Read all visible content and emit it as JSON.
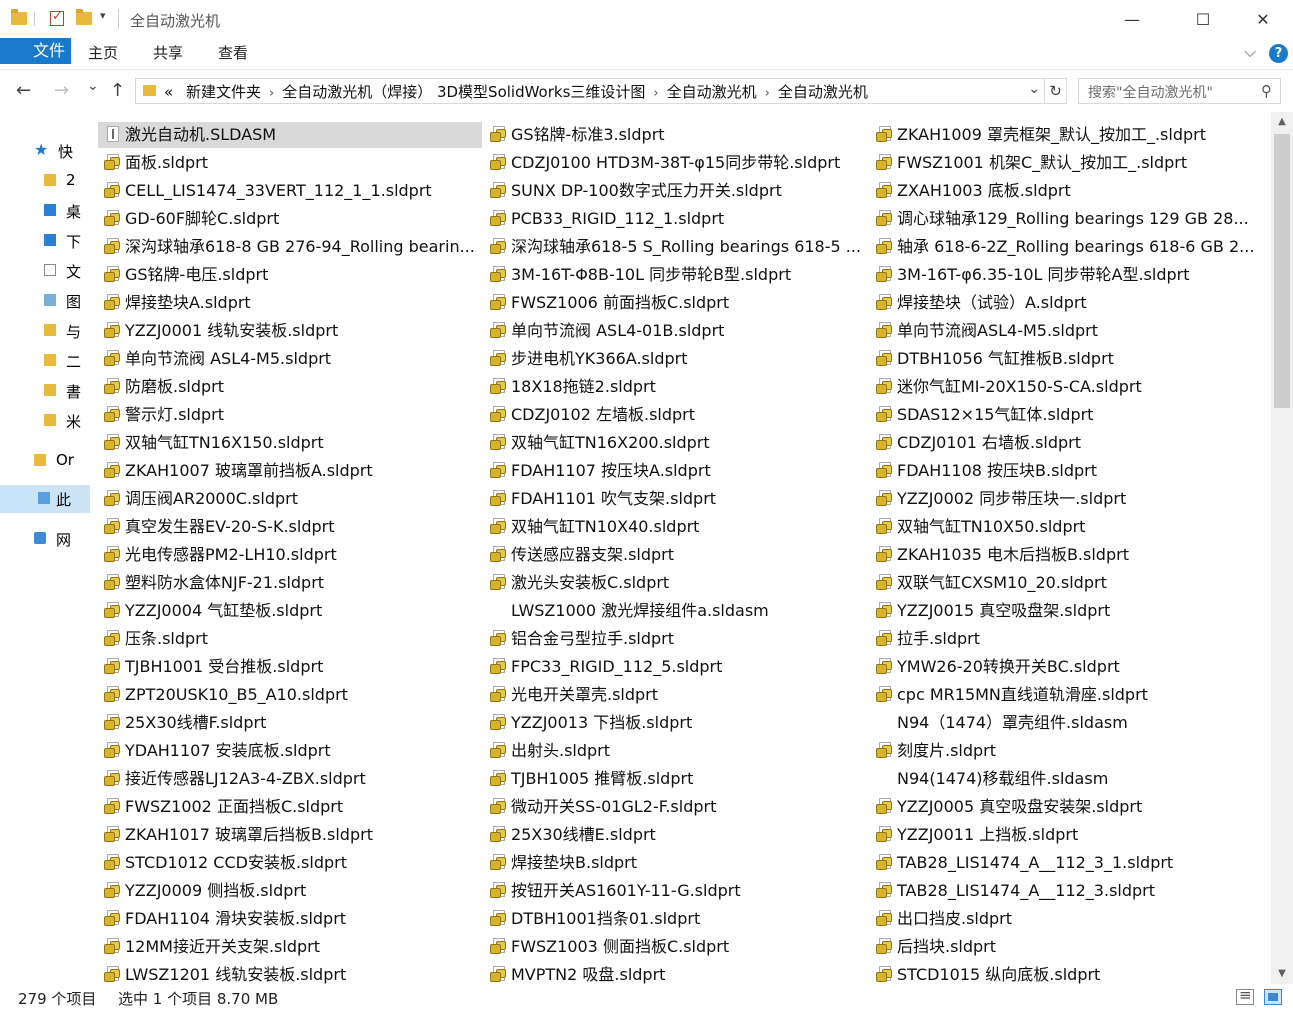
{
  "window": {
    "title": "全自动激光机",
    "minimize_glyph": "—",
    "maximize_glyph": "☐",
    "close_glyph": "✕"
  },
  "ribbon": {
    "tabs": [
      {
        "label": "文件"
      },
      {
        "label": "主页"
      },
      {
        "label": "共享"
      },
      {
        "label": "查看"
      }
    ],
    "collapse_glyph": "⌵",
    "help_glyph": "?"
  },
  "navigation": {
    "back_glyph": "←",
    "forward_glyph": "→",
    "recent_glyph": "⌄",
    "up_glyph": "↑",
    "overflow_glyph": "«",
    "crumbs": [
      "新建文件夹",
      "全自动激光机（焊接） 3D模型SolidWorks三维设计图",
      "全自动激光机",
      "全自动激光机"
    ],
    "dropdown_glyph": "⌄",
    "refresh_glyph": "↻",
    "search_placeholder": "搜索\"全自动激光机\"",
    "search_glyph": "⚲"
  },
  "sidebar": {
    "items": [
      {
        "label": "快"
      },
      {
        "label": "2"
      },
      {
        "label": "桌"
      },
      {
        "label": "下"
      },
      {
        "label": "文"
      },
      {
        "label": "图"
      },
      {
        "label": "与"
      },
      {
        "label": "二"
      },
      {
        "label": "書"
      },
      {
        "label": "米"
      },
      {
        "label": "Or"
      },
      {
        "label": "此"
      },
      {
        "label": "网"
      }
    ]
  },
  "files": {
    "columns": [
      [
        {
          "name": "激光自动机.SLDASM",
          "type": "asm",
          "selected": true
        },
        {
          "name": "面板.sldprt",
          "type": "part"
        },
        {
          "name": "CELL_LIS1474_33VERT_112_1_1.sldprt",
          "type": "part"
        },
        {
          "name": "GD-60F脚轮C.sldprt",
          "type": "part"
        },
        {
          "name": "深沟球轴承618-8 GB 276-94_Rolling bearin...",
          "type": "part"
        },
        {
          "name": "GS铭牌-电压.sldprt",
          "type": "part"
        },
        {
          "name": "焊接垫块A.sldprt",
          "type": "part"
        },
        {
          "name": "YZZJ0001 线轨安装板.sldprt",
          "type": "part"
        },
        {
          "name": "单向节流阀 ASL4-M5.sldprt",
          "type": "part"
        },
        {
          "name": "防磨板.sldprt",
          "type": "part"
        },
        {
          "name": "警示灯.sldprt",
          "type": "part"
        },
        {
          "name": "双轴气缸TN16X150.sldprt",
          "type": "part"
        },
        {
          "name": "ZKAH1007 玻璃罩前挡板A.sldprt",
          "type": "part"
        },
        {
          "name": "调压阀AR2000C.sldprt",
          "type": "part"
        },
        {
          "name": "真空发生器EV-20-S-K.sldprt",
          "type": "part"
        },
        {
          "name": "光电传感器PM2-LH10.sldprt",
          "type": "part"
        },
        {
          "name": "塑料防水盒体NJF-21.sldprt",
          "type": "part"
        },
        {
          "name": "YZZJ0004 气缸垫板.sldprt",
          "type": "part"
        },
        {
          "name": "压条.sldprt",
          "type": "part"
        },
        {
          "name": "TJBH1001 受台推板.sldprt",
          "type": "part"
        },
        {
          "name": "ZPT20USK10_B5_A10.sldprt",
          "type": "part"
        },
        {
          "name": "25X30线槽F.sldprt",
          "type": "part"
        },
        {
          "name": "YDAH1107 安装底板.sldprt",
          "type": "part"
        },
        {
          "name": "接近传感器LJ12A3-4-ZBX.sldprt",
          "type": "part"
        },
        {
          "name": "FWSZ1002 正面挡板C.sldprt",
          "type": "part"
        },
        {
          "name": "ZKAH1017 玻璃罩后挡板B.sldprt",
          "type": "part"
        },
        {
          "name": "STCD1012 CCD安装板.sldprt",
          "type": "part"
        },
        {
          "name": "YZZJ0009 侧挡板.sldprt",
          "type": "part"
        },
        {
          "name": "FDAH1104 滑块安装板.sldprt",
          "type": "part"
        },
        {
          "name": "12MM接近开关支架.sldprt",
          "type": "part"
        },
        {
          "name": "LWSZ1201 线轨安装板.sldprt",
          "type": "part"
        }
      ],
      [
        {
          "name": "GS铭牌-标准3.sldprt",
          "type": "part"
        },
        {
          "name": "CDZJ0100 HTD3M-38T-φ15同步带轮.sldprt",
          "type": "part"
        },
        {
          "name": "SUNX DP-100数字式压力开关.sldprt",
          "type": "part"
        },
        {
          "name": "PCB33_RIGID_112_1.sldprt",
          "type": "part"
        },
        {
          "name": "深沟球轴承618-5 S_Rolling bearings 618-5 ...",
          "type": "part"
        },
        {
          "name": "3M-16T-Φ8B-10L 同步带轮B型.sldprt",
          "type": "part"
        },
        {
          "name": "FWSZ1006 前面挡板C.sldprt",
          "type": "part"
        },
        {
          "name": "单向节流阀 ASL4-01B.sldprt",
          "type": "part"
        },
        {
          "name": "步进电机YK366A.sldprt",
          "type": "part"
        },
        {
          "name": "18X18拖链2.sldprt",
          "type": "part"
        },
        {
          "name": "CDZJ0102 左墙板.sldprt",
          "type": "part"
        },
        {
          "name": "双轴气缸TN16X200.sldprt",
          "type": "part"
        },
        {
          "name": "FDAH1107 按压块A.sldprt",
          "type": "part"
        },
        {
          "name": "FDAH1101 吹气支架.sldprt",
          "type": "part"
        },
        {
          "name": "双轴气缸TN10X40.sldprt",
          "type": "part"
        },
        {
          "name": "传送感应器支架.sldprt",
          "type": "part"
        },
        {
          "name": "激光头安装板C.sldprt",
          "type": "part"
        },
        {
          "name": "LWSZ1000 激光焊接组件a.sldasm",
          "type": "none"
        },
        {
          "name": "铝合金弓型拉手.sldprt",
          "type": "part"
        },
        {
          "name": "FPC33_RIGID_112_5.sldprt",
          "type": "part"
        },
        {
          "name": "光电开关罩壳.sldprt",
          "type": "part"
        },
        {
          "name": "YZZJ0013 下挡板.sldprt",
          "type": "part"
        },
        {
          "name": "出射头.sldprt",
          "type": "part"
        },
        {
          "name": "TJBH1005 推臂板.sldprt",
          "type": "part"
        },
        {
          "name": "微动开关SS-01GL2-F.sldprt",
          "type": "part"
        },
        {
          "name": "25X30线槽E.sldprt",
          "type": "part"
        },
        {
          "name": "焊接垫块B.sldprt",
          "type": "part"
        },
        {
          "name": "按钮开关AS1601Y-11-G.sldprt",
          "type": "part"
        },
        {
          "name": "DTBH1001挡条01.sldprt",
          "type": "part"
        },
        {
          "name": "FWSZ1003 侧面挡板C.sldprt",
          "type": "part"
        },
        {
          "name": "MVPTN2 吸盘.sldprt",
          "type": "part"
        }
      ],
      [
        {
          "name": "ZKAH1009 罩壳框架_默认_按加工_.sldprt",
          "type": "part"
        },
        {
          "name": "FWSZ1001 机架C_默认_按加工_.sldprt",
          "type": "part"
        },
        {
          "name": "ZXAH1003 底板.sldprt",
          "type": "part"
        },
        {
          "name": "调心球轴承129_Rolling bearings 129 GB 28...",
          "type": "part"
        },
        {
          "name": "轴承 618-6-2Z_Rolling bearings 618-6 GB 2...",
          "type": "part"
        },
        {
          "name": "3M-16T-φ6.35-10L 同步带轮A型.sldprt",
          "type": "part"
        },
        {
          "name": "焊接垫块（试验）A.sldprt",
          "type": "part"
        },
        {
          "name": "单向节流阀ASL4-M5.sldprt",
          "type": "part"
        },
        {
          "name": "DTBH1056 气缸推板B.sldprt",
          "type": "part"
        },
        {
          "name": "迷你气缸MI-20X150-S-CA.sldprt",
          "type": "part"
        },
        {
          "name": "SDAS12×15气缸体.sldprt",
          "type": "part"
        },
        {
          "name": "CDZJ0101 右墙板.sldprt",
          "type": "part"
        },
        {
          "name": "FDAH1108 按压块B.sldprt",
          "type": "part"
        },
        {
          "name": "YZZJ0002 同步带压块一.sldprt",
          "type": "part"
        },
        {
          "name": "双轴气缸TN10X50.sldprt",
          "type": "part"
        },
        {
          "name": "ZKAH1035 电木后挡板B.sldprt",
          "type": "part"
        },
        {
          "name": "双联气缸CXSM10_20.sldprt",
          "type": "part"
        },
        {
          "name": "YZZJ0015 真空吸盘架.sldprt",
          "type": "part"
        },
        {
          "name": "拉手.sldprt",
          "type": "part"
        },
        {
          "name": "YMW26-20转换开关BC.sldprt",
          "type": "part"
        },
        {
          "name": "cpc MR15MN直线道轨滑座.sldprt",
          "type": "part"
        },
        {
          "name": "N94（1474）罩壳组件.sldasm",
          "type": "none"
        },
        {
          "name": "刻度片.sldprt",
          "type": "part"
        },
        {
          "name": "N94(1474)移载组件.sldasm",
          "type": "none"
        },
        {
          "name": "YZZJ0005 真空吸盘安装架.sldprt",
          "type": "part"
        },
        {
          "name": "YZZJ0011 上挡板.sldprt",
          "type": "part"
        },
        {
          "name": "TAB28_LIS1474_A__112_3_1.sldprt",
          "type": "part"
        },
        {
          "name": "TAB28_LIS1474_A__112_3.sldprt",
          "type": "part"
        },
        {
          "name": "出口挡皮.sldprt",
          "type": "part"
        },
        {
          "name": "后挡块.sldprt",
          "type": "part"
        },
        {
          "name": "STCD1015 纵向底板.sldprt",
          "type": "part"
        }
      ]
    ]
  },
  "status_bar": {
    "item_count": "279 个项目",
    "selection": "选中 1 个项目  8.70 MB"
  },
  "scrollbar": {
    "up_glyph": "▲",
    "down_glyph": "▼"
  }
}
